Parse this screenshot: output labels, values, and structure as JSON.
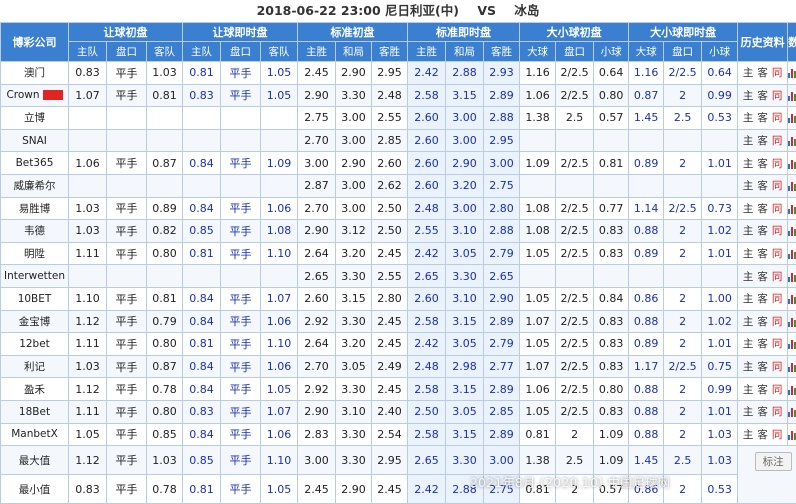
{
  "header": {
    "datetime": "2018-06-22 23:00",
    "home": "尼日利亚(中)",
    "vs": "VS",
    "away": "冰岛"
  },
  "groups": {
    "company": "博彩公司",
    "ah_open": "让球初盘",
    "ah_live": "让球即时盘",
    "std_open": "标准初盘",
    "std_live": "标准即时盘",
    "ou_open": "大小球初盘",
    "ou_live": "大小球即时盘",
    "history": "历史资料",
    "data": "数据"
  },
  "subheaders": {
    "home": "主队",
    "line": "盘口",
    "away": "客队",
    "win": "主胜",
    "draw": "和局",
    "lose": "客胜",
    "over": "大球",
    "ou_line": "盘口",
    "under": "小球"
  },
  "history_links": {
    "zhu": "主",
    "ke": "客",
    "tong": "同"
  },
  "icons": {
    "chart": "bar-chart-icon",
    "search": "magnifier-icon"
  },
  "rows": [
    {
      "company": "澳门",
      "ah_open": [
        "0.83",
        "平手",
        "1.03"
      ],
      "ah_live": [
        "0.81",
        "平手",
        "1.05"
      ],
      "std_open": [
        "2.45",
        "2.90",
        "2.95"
      ],
      "std_live": [
        "2.42",
        "2.88",
        "2.93"
      ],
      "ou_open": [
        "1.16",
        "2/2.5",
        "0.64"
      ],
      "ou_live": [
        "1.16",
        "2/2.5",
        "0.64"
      ]
    },
    {
      "company": "Crown",
      "crown": true,
      "ah_open": [
        "1.07",
        "平手",
        "0.81"
      ],
      "ah_live": [
        "0.83",
        "平手",
        "1.05"
      ],
      "std_open": [
        "2.90",
        "3.30",
        "2.48"
      ],
      "std_live": [
        "2.58",
        "3.15",
        "2.89"
      ],
      "ou_open": [
        "1.06",
        "2/2.5",
        "0.80"
      ],
      "ou_live": [
        "0.87",
        "2",
        "0.99"
      ]
    },
    {
      "company": "立博",
      "ah_open": [
        "",
        "",
        ""
      ],
      "ah_live": [
        "",
        "",
        ""
      ],
      "std_open": [
        "2.75",
        "3.00",
        "2.55"
      ],
      "std_live": [
        "2.60",
        "3.00",
        "2.88"
      ],
      "ou_open": [
        "1.38",
        "2.5",
        "0.57"
      ],
      "ou_live": [
        "1.45",
        "2.5",
        "0.53"
      ]
    },
    {
      "company": "SNAI",
      "ah_open": [
        "",
        "",
        ""
      ],
      "ah_live": [
        "",
        "",
        ""
      ],
      "std_open": [
        "2.70",
        "3.00",
        "2.85"
      ],
      "std_live": [
        "2.60",
        "3.00",
        "2.95"
      ],
      "ou_open": [
        "",
        "",
        ""
      ],
      "ou_live": [
        "",
        "",
        ""
      ]
    },
    {
      "company": "Bet365",
      "ah_open": [
        "1.06",
        "平手",
        "0.87"
      ],
      "ah_live": [
        "0.84",
        "平手",
        "1.09"
      ],
      "std_open": [
        "3.00",
        "2.90",
        "2.60"
      ],
      "std_live": [
        "2.60",
        "2.90",
        "3.00"
      ],
      "ou_open": [
        "1.09",
        "2/2.5",
        "0.81"
      ],
      "ou_live": [
        "0.89",
        "2",
        "1.01"
      ]
    },
    {
      "company": "威廉希尔",
      "ah_open": [
        "",
        "",
        ""
      ],
      "ah_live": [
        "",
        "",
        ""
      ],
      "std_open": [
        "2.87",
        "3.00",
        "2.62"
      ],
      "std_live": [
        "2.60",
        "3.20",
        "2.75"
      ],
      "ou_open": [
        "",
        "",
        ""
      ],
      "ou_live": [
        "",
        "",
        ""
      ]
    },
    {
      "company": "易胜博",
      "ah_open": [
        "1.03",
        "平手",
        "0.89"
      ],
      "ah_live": [
        "0.84",
        "平手",
        "1.06"
      ],
      "std_open": [
        "2.70",
        "3.00",
        "2.50"
      ],
      "std_live": [
        "2.48",
        "3.00",
        "2.80"
      ],
      "ou_open": [
        "1.08",
        "2/2.5",
        "0.77"
      ],
      "ou_live": [
        "1.14",
        "2/2.5",
        "0.73"
      ]
    },
    {
      "company": "韦德",
      "ah_open": [
        "1.03",
        "平手",
        "0.82"
      ],
      "ah_live": [
        "0.85",
        "平手",
        "1.08"
      ],
      "std_open": [
        "2.90",
        "3.12",
        "2.50"
      ],
      "std_live": [
        "2.55",
        "3.10",
        "2.88"
      ],
      "ou_open": [
        "1.08",
        "2/2.5",
        "0.83"
      ],
      "ou_live": [
        "0.88",
        "2",
        "1.02"
      ]
    },
    {
      "company": "明陞",
      "ah_open": [
        "1.11",
        "平手",
        "0.80"
      ],
      "ah_live": [
        "0.81",
        "平手",
        "1.10"
      ],
      "std_open": [
        "2.64",
        "3.20",
        "2.45"
      ],
      "std_live": [
        "2.42",
        "3.05",
        "2.79"
      ],
      "ou_open": [
        "1.05",
        "2/2.5",
        "0.83"
      ],
      "ou_live": [
        "0.89",
        "2",
        "1.01"
      ]
    },
    {
      "company": "Interwetten",
      "ah_open": [
        "",
        "",
        ""
      ],
      "ah_live": [
        "",
        "",
        ""
      ],
      "std_open": [
        "2.65",
        "3.30",
        "2.55"
      ],
      "std_live": [
        "2.65",
        "3.30",
        "2.65"
      ],
      "ou_open": [
        "",
        "",
        ""
      ],
      "ou_live": [
        "",
        "",
        ""
      ]
    },
    {
      "company": "10BET",
      "ah_open": [
        "1.10",
        "平手",
        "0.81"
      ],
      "ah_live": [
        "0.84",
        "平手",
        "1.07"
      ],
      "std_open": [
        "2.60",
        "3.15",
        "2.80"
      ],
      "std_live": [
        "2.60",
        "3.10",
        "2.90"
      ],
      "ou_open": [
        "1.05",
        "2/2.5",
        "0.84"
      ],
      "ou_live": [
        "0.86",
        "2",
        "1.00"
      ]
    },
    {
      "company": "金宝博",
      "ah_open": [
        "1.12",
        "平手",
        "0.79"
      ],
      "ah_live": [
        "0.84",
        "平手",
        "1.06"
      ],
      "std_open": [
        "2.92",
        "3.30",
        "2.45"
      ],
      "std_live": [
        "2.58",
        "3.15",
        "2.89"
      ],
      "ou_open": [
        "1.07",
        "2/2.5",
        "0.83"
      ],
      "ou_live": [
        "0.88",
        "2",
        "1.02"
      ]
    },
    {
      "company": "12bet",
      "ah_open": [
        "1.11",
        "平手",
        "0.80"
      ],
      "ah_live": [
        "0.81",
        "平手",
        "1.10"
      ],
      "std_open": [
        "2.64",
        "3.20",
        "2.45"
      ],
      "std_live": [
        "2.42",
        "3.05",
        "2.79"
      ],
      "ou_open": [
        "1.05",
        "2/2.5",
        "0.83"
      ],
      "ou_live": [
        "0.89",
        "2",
        "1.01"
      ]
    },
    {
      "company": "利记",
      "ah_open": [
        "1.03",
        "平手",
        "0.87"
      ],
      "ah_live": [
        "0.84",
        "平手",
        "1.06"
      ],
      "std_open": [
        "2.70",
        "3.05",
        "2.49"
      ],
      "std_live": [
        "2.48",
        "2.98",
        "2.77"
      ],
      "ou_open": [
        "1.07",
        "2/2.5",
        "0.83"
      ],
      "ou_live": [
        "1.17",
        "2/2.5",
        "0.75"
      ]
    },
    {
      "company": "盈禾",
      "ah_open": [
        "1.12",
        "平手",
        "0.78"
      ],
      "ah_live": [
        "0.84",
        "平手",
        "1.05"
      ],
      "std_open": [
        "2.92",
        "3.30",
        "2.45"
      ],
      "std_live": [
        "2.58",
        "3.15",
        "2.89"
      ],
      "ou_open": [
        "1.06",
        "2/2.5",
        "0.80"
      ],
      "ou_live": [
        "0.88",
        "2",
        "0.99"
      ]
    },
    {
      "company": "18Bet",
      "ah_open": [
        "1.11",
        "平手",
        "0.80"
      ],
      "ah_live": [
        "0.83",
        "平手",
        "1.07"
      ],
      "std_open": [
        "2.90",
        "3.10",
        "2.40"
      ],
      "std_live": [
        "2.50",
        "3.05",
        "2.85"
      ],
      "ou_open": [
        "1.05",
        "2/2.5",
        "0.83"
      ],
      "ou_live": [
        "0.88",
        "2",
        "1.01"
      ]
    },
    {
      "company": "ManbetX",
      "ah_open": [
        "1.05",
        "平手",
        "0.85"
      ],
      "ah_live": [
        "0.84",
        "平手",
        "1.06"
      ],
      "std_open": [
        "2.83",
        "3.30",
        "2.54"
      ],
      "std_live": [
        "2.58",
        "3.15",
        "2.89"
      ],
      "ou_open": [
        "0.81",
        "2",
        "1.09"
      ],
      "ou_live": [
        "0.88",
        "2",
        "1.03"
      ]
    }
  ],
  "summary": [
    {
      "label": "最大值",
      "ah_open": [
        "1.12",
        "平手",
        "1.03"
      ],
      "ah_live": [
        "0.85",
        "平手",
        "1.10"
      ],
      "std_open": [
        "3.00",
        "3.30",
        "2.95"
      ],
      "std_live": [
        "2.65",
        "3.30",
        "3.00"
      ],
      "ou_open": [
        "1.38",
        "2.5",
        "1.09"
      ],
      "ou_live": [
        "1.45",
        "2.5",
        "1.03"
      ]
    },
    {
      "label": "最小值",
      "ah_open": [
        "0.83",
        "平手",
        "0.78"
      ],
      "ah_live": [
        "0.81",
        "平手",
        "1.05"
      ],
      "std_open": [
        "2.45",
        "2.90",
        "2.45"
      ],
      "std_live": [
        "2.42",
        "2.88",
        "2.75"
      ],
      "ou_open": [
        "0.81",
        "2",
        "0.57"
      ],
      "ou_live": [
        "0.86",
        "2",
        "0.53"
      ]
    }
  ],
  "note_button": "标注",
  "watermark": "2021年8月 (2020.10) 中国足球网"
}
